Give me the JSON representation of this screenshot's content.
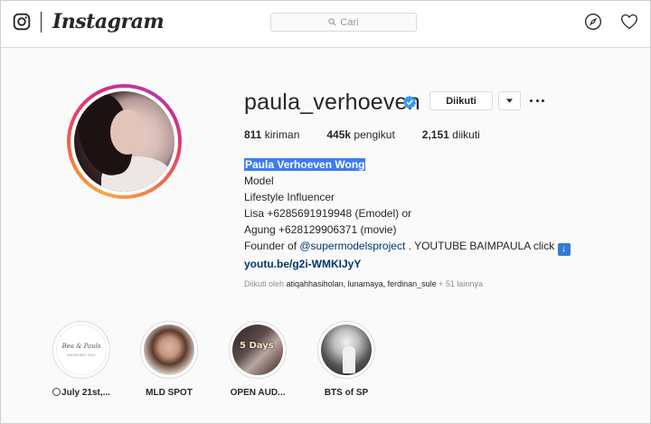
{
  "nav": {
    "wordmark": "Instagram",
    "search_placeholder": "Cari"
  },
  "profile": {
    "username": "paula_verhoeven",
    "follow_button_label": "Diikuti",
    "stats": [
      {
        "value": "811",
        "label": "kiriman"
      },
      {
        "value": "445k",
        "label": "pengikut"
      },
      {
        "value": "2,151",
        "label": "diikuti"
      }
    ],
    "bio": {
      "name": "Paula Verhoeven Wong",
      "line1": "Model",
      "line2": "Lifestyle Influencer",
      "line3": "Lisa +6285691919948 (Emodel) or",
      "line4": "Agung +628129906371 (movie)",
      "line5_prefix": "Founder of ",
      "line5_mention": "@supermodelsproject",
      "line5_suffix": " . YOUTUBE BAIMPAULA click ",
      "line5_emoji": "↓",
      "link": "youtu.be/g2i-WMKIJyY"
    },
    "followed_by": {
      "prefix": "Diikuti oleh ",
      "names": "atiqahhasiholan, lunamaya, ferdinan_sule",
      "suffix": " + 51 lainnya"
    }
  },
  "highlights": [
    {
      "label": "July 21st,...",
      "image_text": "Bea & Pauls",
      "image_subtext": "WEDDING DAY"
    },
    {
      "label": "MLD SPOT"
    },
    {
      "label": "OPEN AUD...",
      "image_text": "5 Days"
    },
    {
      "label": "BTS of SP"
    }
  ],
  "colors": {
    "accent_link": "#00376b",
    "selection_highlight": "#3d7cf0",
    "verified_badge": "#3897f0",
    "muted_text": "#8e8e8e"
  }
}
